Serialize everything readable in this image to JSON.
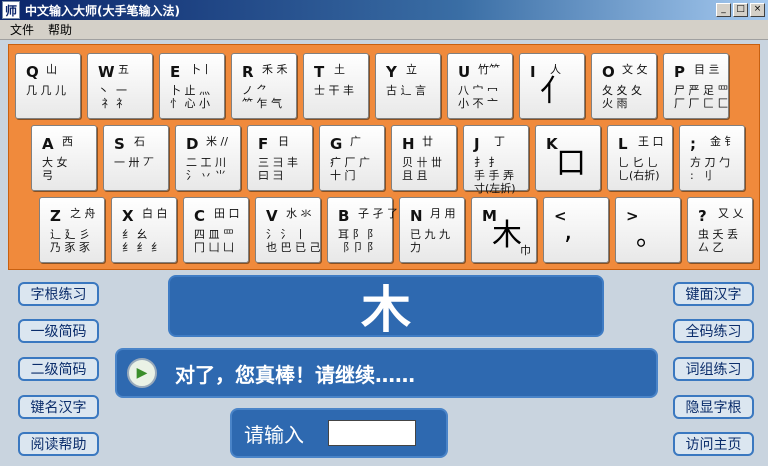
{
  "window": {
    "icon": "师",
    "title": "中文输入大师(大手笔输入法)",
    "min": "_",
    "max": "□",
    "close": "×"
  },
  "menu": [
    "文件",
    "帮助"
  ],
  "keys": [
    {
      "id": "q",
      "letter": "Q",
      "top": "山",
      "rad": "几 几 儿"
    },
    {
      "id": "w",
      "letter": "W",
      "top": "五",
      "rad": "丶  一\n 礻 礻"
    },
    {
      "id": "e",
      "letter": "E",
      "top": "卜丨",
      "rad": "卜 止 灬\n忄 心 小"
    },
    {
      "id": "r",
      "letter": "R",
      "top": "禾 禾",
      "rad": "ノ ⺈\n⺮ 乍 气"
    },
    {
      "id": "t",
      "letter": "T",
      "top": "土",
      "rad": "士 干 丰"
    },
    {
      "id": "y",
      "letter": "Y",
      "top": "立",
      "rad": "古 辶 言"
    },
    {
      "id": "u",
      "letter": "U",
      "top": "竹⺮",
      "rad": "八 宀 冖\n小 不 亠"
    },
    {
      "id": "i",
      "letter": "I",
      "top": "人",
      "big": "亻"
    },
    {
      "id": "o",
      "letter": "O",
      "top": "文 攵",
      "rad": "夂 夊 夂\n火 雨"
    },
    {
      "id": "p",
      "letter": "P",
      "top": "目 亖",
      "rad": "尸 严 足 罒\n厂 厂 匚 匚"
    },
    {
      "id": "a",
      "letter": "A",
      "top": "西",
      "rad": "大 女\n弓"
    },
    {
      "id": "s",
      "letter": "S",
      "top": "石",
      "rad": "一 卅 丆"
    },
    {
      "id": "d",
      "letter": "D",
      "top": "米 //",
      "rad": "二 工 川\n氵 丷 ⺌"
    },
    {
      "id": "f",
      "letter": "F",
      "top": "日",
      "rad": "三 ⺕ 丰\n曰 ⺕"
    },
    {
      "id": "g",
      "letter": "G",
      "top": "广",
      "rad": "疒 厂 广\n十 门"
    },
    {
      "id": "h",
      "letter": "H",
      "top": "廿",
      "rad": "贝 卄 丗\n且 且"
    },
    {
      "id": "j",
      "letter": "J",
      "top": "丁",
      "rad": "扌 扌\n手 手 弄\n寸(左折)"
    },
    {
      "id": "k",
      "letter": "K",
      "big": "口"
    },
    {
      "id": "l",
      "letter": "L",
      "top": "王 口",
      "rad": "乚 匕 乚\n乚(右折)"
    },
    {
      "id": "semi",
      "letter": ";",
      "top": "金 钅",
      "rad": "方 刀 勹\n:  刂"
    },
    {
      "id": "z",
      "letter": "Z",
      "top": "之 舟",
      "rad": "辶 廴 彡\n乃 豕 豕"
    },
    {
      "id": "x",
      "letter": "X",
      "top": "白 白",
      "rad": "纟 幺\n纟 纟 纟"
    },
    {
      "id": "c",
      "letter": "C",
      "top": "田 口",
      "rad": "四 皿 罒\n冂 凵 凵"
    },
    {
      "id": "v",
      "letter": "V",
      "top": "水 氺",
      "rad": "氵 ⺡ 丨\n也 巴 已 己"
    },
    {
      "id": "b",
      "letter": "B",
      "top": "子 孑 了",
      "rad": "耳 阝 阝\n⻏ 卩 阝"
    },
    {
      "id": "n",
      "letter": "N",
      "top": "月 用",
      "rad": "已 九 九\n力"
    },
    {
      "id": "m",
      "letter": "M",
      "big": "木",
      "sub": "巾"
    },
    {
      "id": "comma",
      "letter": "<",
      "big": ","
    },
    {
      "id": "period",
      "letter": ">",
      "big": "。"
    },
    {
      "id": "slash",
      "letter": "?",
      "top": "又 乂",
      "rad": "虫 夭 丢\n厶 乙"
    }
  ],
  "left_buttons": [
    "字根练习",
    "一级简码",
    "二级简码",
    "键名汉字",
    "阅读帮助"
  ],
  "right_buttons": [
    "键面汉字",
    "全码练习",
    "词组练习",
    "隐显字根",
    "访问主页"
  ],
  "current_char": "木",
  "feedback": "对了，您真棒！请继续……",
  "input": {
    "label": "请输入",
    "value": ""
  },
  "icons": {
    "play": "play-arrow-icon"
  },
  "colors": {
    "keyboard_bg": "#f08a3c",
    "panel": "#2e69b0",
    "title_bar": "#0a246a"
  }
}
